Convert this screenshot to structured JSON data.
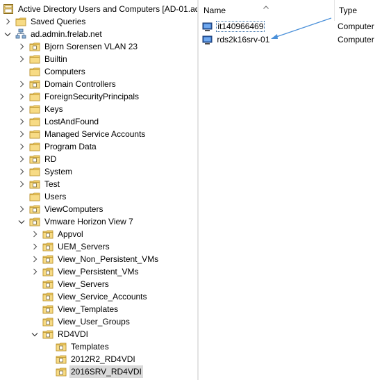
{
  "tree": {
    "root": {
      "label": "Active Directory Users and Computers [AD-01.ad",
      "icon": "aduc-console-icon"
    },
    "items": [
      {
        "label": "Saved Queries",
        "depth": 1,
        "expander": "collapsed",
        "icon": "folder-icon"
      },
      {
        "label": "ad.admin.frelab.net",
        "depth": 1,
        "expander": "expanded",
        "icon": "domain-icon"
      },
      {
        "label": "Bjorn Sorensen VLAN 23",
        "depth": 2,
        "expander": "collapsed",
        "icon": "ou-icon"
      },
      {
        "label": "Builtin",
        "depth": 2,
        "expander": "collapsed",
        "icon": "folder-icon"
      },
      {
        "label": "Computers",
        "depth": 2,
        "expander": "none",
        "icon": "folder-icon"
      },
      {
        "label": "Domain Controllers",
        "depth": 2,
        "expander": "collapsed",
        "icon": "ou-icon"
      },
      {
        "label": "ForeignSecurityPrincipals",
        "depth": 2,
        "expander": "collapsed",
        "icon": "folder-icon"
      },
      {
        "label": "Keys",
        "depth": 2,
        "expander": "collapsed",
        "icon": "folder-icon"
      },
      {
        "label": "LostAndFound",
        "depth": 2,
        "expander": "collapsed",
        "icon": "folder-icon"
      },
      {
        "label": "Managed Service Accounts",
        "depth": 2,
        "expander": "collapsed",
        "icon": "folder-icon"
      },
      {
        "label": "Program Data",
        "depth": 2,
        "expander": "collapsed",
        "icon": "folder-icon"
      },
      {
        "label": "RD",
        "depth": 2,
        "expander": "collapsed",
        "icon": "ou-icon"
      },
      {
        "label": "System",
        "depth": 2,
        "expander": "collapsed",
        "icon": "folder-icon"
      },
      {
        "label": "Test",
        "depth": 2,
        "expander": "collapsed",
        "icon": "ou-icon"
      },
      {
        "label": "Users",
        "depth": 2,
        "expander": "none",
        "icon": "folder-icon"
      },
      {
        "label": "ViewComputers",
        "depth": 2,
        "expander": "collapsed",
        "icon": "ou-icon"
      },
      {
        "label": "Vmware Horizon View 7",
        "depth": 2,
        "expander": "expanded",
        "icon": "ou-icon"
      },
      {
        "label": "Appvol",
        "depth": 3,
        "expander": "collapsed",
        "icon": "ou-icon"
      },
      {
        "label": "UEM_Servers",
        "depth": 3,
        "expander": "collapsed",
        "icon": "ou-icon"
      },
      {
        "label": "View_Non_Persistent_VMs",
        "depth": 3,
        "expander": "collapsed",
        "icon": "ou-icon"
      },
      {
        "label": "View_Persistent_VMs",
        "depth": 3,
        "expander": "collapsed",
        "icon": "ou-icon"
      },
      {
        "label": "View_Servers",
        "depth": 3,
        "expander": "none",
        "icon": "ou-icon"
      },
      {
        "label": "View_Service_Accounts",
        "depth": 3,
        "expander": "none",
        "icon": "ou-icon"
      },
      {
        "label": "View_Templates",
        "depth": 3,
        "expander": "none",
        "icon": "ou-icon"
      },
      {
        "label": "View_User_Groups",
        "depth": 3,
        "expander": "none",
        "icon": "ou-icon"
      },
      {
        "label": "RD4VDI",
        "depth": 3,
        "expander": "expanded",
        "icon": "ou-icon"
      },
      {
        "label": "Templates",
        "depth": 4,
        "expander": "none",
        "icon": "ou-icon"
      },
      {
        "label": "2012R2_RD4VDI",
        "depth": 4,
        "expander": "none",
        "icon": "ou-icon"
      },
      {
        "label": "2016SRV_RD4VDI",
        "depth": 4,
        "expander": "none",
        "icon": "ou-icon",
        "selected": true
      }
    ]
  },
  "list": {
    "columns": [
      {
        "label": "Name",
        "sorted": "ascending"
      },
      {
        "label": "Type"
      }
    ],
    "rows": [
      {
        "name": "it140966469",
        "type": "Computer",
        "icon": "computer-icon"
      },
      {
        "name": "rds2k16srv-01",
        "type": "Computer",
        "icon": "computer-icon"
      }
    ]
  },
  "colors": {
    "selection": "#d9d9d9",
    "annotation_arrow": "#4a90d9",
    "folder": "#e8c35a"
  }
}
